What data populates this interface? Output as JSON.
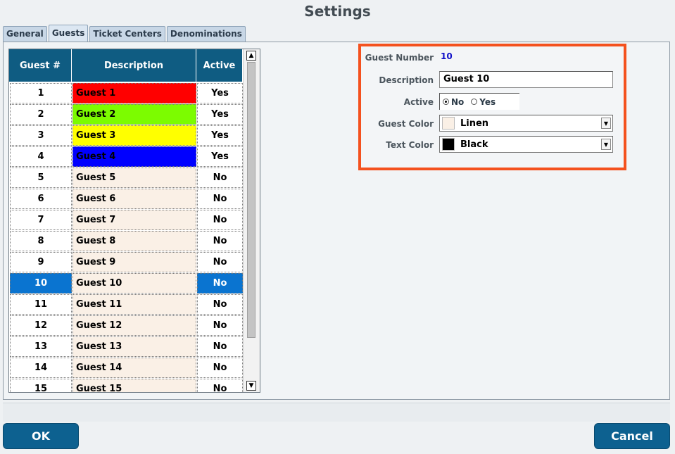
{
  "window": {
    "title": "Settings"
  },
  "tabs": [
    {
      "label": "General",
      "active": false
    },
    {
      "label": "Guests",
      "active": true
    },
    {
      "label": "Ticket Centers",
      "active": false
    },
    {
      "label": "Denominations",
      "active": false
    }
  ],
  "grid": {
    "headers": {
      "number": "Guest #",
      "description": "Description",
      "active": "Active"
    },
    "rows": [
      {
        "number": "1",
        "description": "Guest 1",
        "active": "Yes",
        "color": "#ff0000"
      },
      {
        "number": "2",
        "description": "Guest 2",
        "active": "Yes",
        "color": "#7cfc00"
      },
      {
        "number": "3",
        "description": "Guest 3",
        "active": "Yes",
        "color": "#ffff00"
      },
      {
        "number": "4",
        "description": "Guest 4",
        "active": "Yes",
        "color": "#0000ff"
      },
      {
        "number": "5",
        "description": "Guest 5",
        "active": "No",
        "color": "#faf0e6"
      },
      {
        "number": "6",
        "description": "Guest 6",
        "active": "No",
        "color": "#faf0e6"
      },
      {
        "number": "7",
        "description": "Guest 7",
        "active": "No",
        "color": "#faf0e6"
      },
      {
        "number": "8",
        "description": "Guest 8",
        "active": "No",
        "color": "#faf0e6"
      },
      {
        "number": "9",
        "description": "Guest 9",
        "active": "No",
        "color": "#faf0e6"
      },
      {
        "number": "10",
        "description": "Guest 10",
        "active": "No",
        "color": "#faf0e6",
        "selected": true
      },
      {
        "number": "11",
        "description": "Guest 11",
        "active": "No",
        "color": "#faf0e6"
      },
      {
        "number": "12",
        "description": "Guest 12",
        "active": "No",
        "color": "#faf0e6"
      },
      {
        "number": "13",
        "description": "Guest 13",
        "active": "No",
        "color": "#faf0e6"
      },
      {
        "number": "14",
        "description": "Guest 14",
        "active": "No",
        "color": "#faf0e6"
      },
      {
        "number": "15",
        "description": "Guest 15",
        "active": "No",
        "color": "#faf0e6"
      }
    ]
  },
  "detail": {
    "guest_number_label": "Guest Number",
    "guest_number_value": "10",
    "description_label": "Description",
    "description_value": "Guest 10",
    "active_label": "Active",
    "active_no": "No",
    "active_yes": "Yes",
    "active_selected": "No",
    "guest_color_label": "Guest Color",
    "guest_color_value": "Linen",
    "guest_color_swatch": "#faf0e6",
    "text_color_label": "Text Color",
    "text_color_value": "Black",
    "text_color_swatch": "#000000"
  },
  "buttons": {
    "ok": "OK",
    "cancel": "Cancel"
  },
  "colors": {
    "accent": "#0d6190",
    "highlight_border": "#f4511e",
    "selection": "#0a74d0"
  },
  "icons": {
    "scroll_up": "scroll-up-arrow-icon",
    "scroll_down": "scroll-down-arrow-icon",
    "dropdown": "chevron-down-icon"
  }
}
